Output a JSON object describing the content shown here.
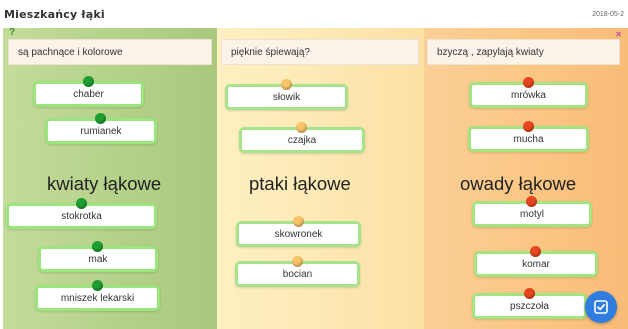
{
  "app": {
    "title": "Mieszkańcy łąki",
    "date": "2018-05-2"
  },
  "colors": {
    "column_green": "#bcd793",
    "column_yellow": "#fde6b3",
    "column_orange": "#fbc78b",
    "card_border": "#a3e380",
    "dot_green": "#1f9e30",
    "dot_yellow": "#f7c46a",
    "dot_red": "#e9461f",
    "check_button": "#2f7de1"
  },
  "columns": [
    {
      "question": "są pachnące i kolorowe",
      "category": "kwiaty łąkowe",
      "dot": "green",
      "items": [
        "chaber",
        "rumianek",
        "stokrotka",
        "mak",
        "mniszek lekarski"
      ]
    },
    {
      "question": "pięknie śpiewają?",
      "category": "ptaki łąkowe",
      "dot": "yellow",
      "items": [
        "słowik",
        "czajka",
        "skowronek",
        "bocian"
      ]
    },
    {
      "question": "bzyczą , zapylają kwiaty",
      "category": "owady łąkowe",
      "dot": "red",
      "items": [
        "mrówka",
        "mucha",
        "motyl",
        "komar",
        "pszczoła"
      ]
    }
  ],
  "buttons": {
    "check": "check-icon",
    "help": "help-icon"
  }
}
